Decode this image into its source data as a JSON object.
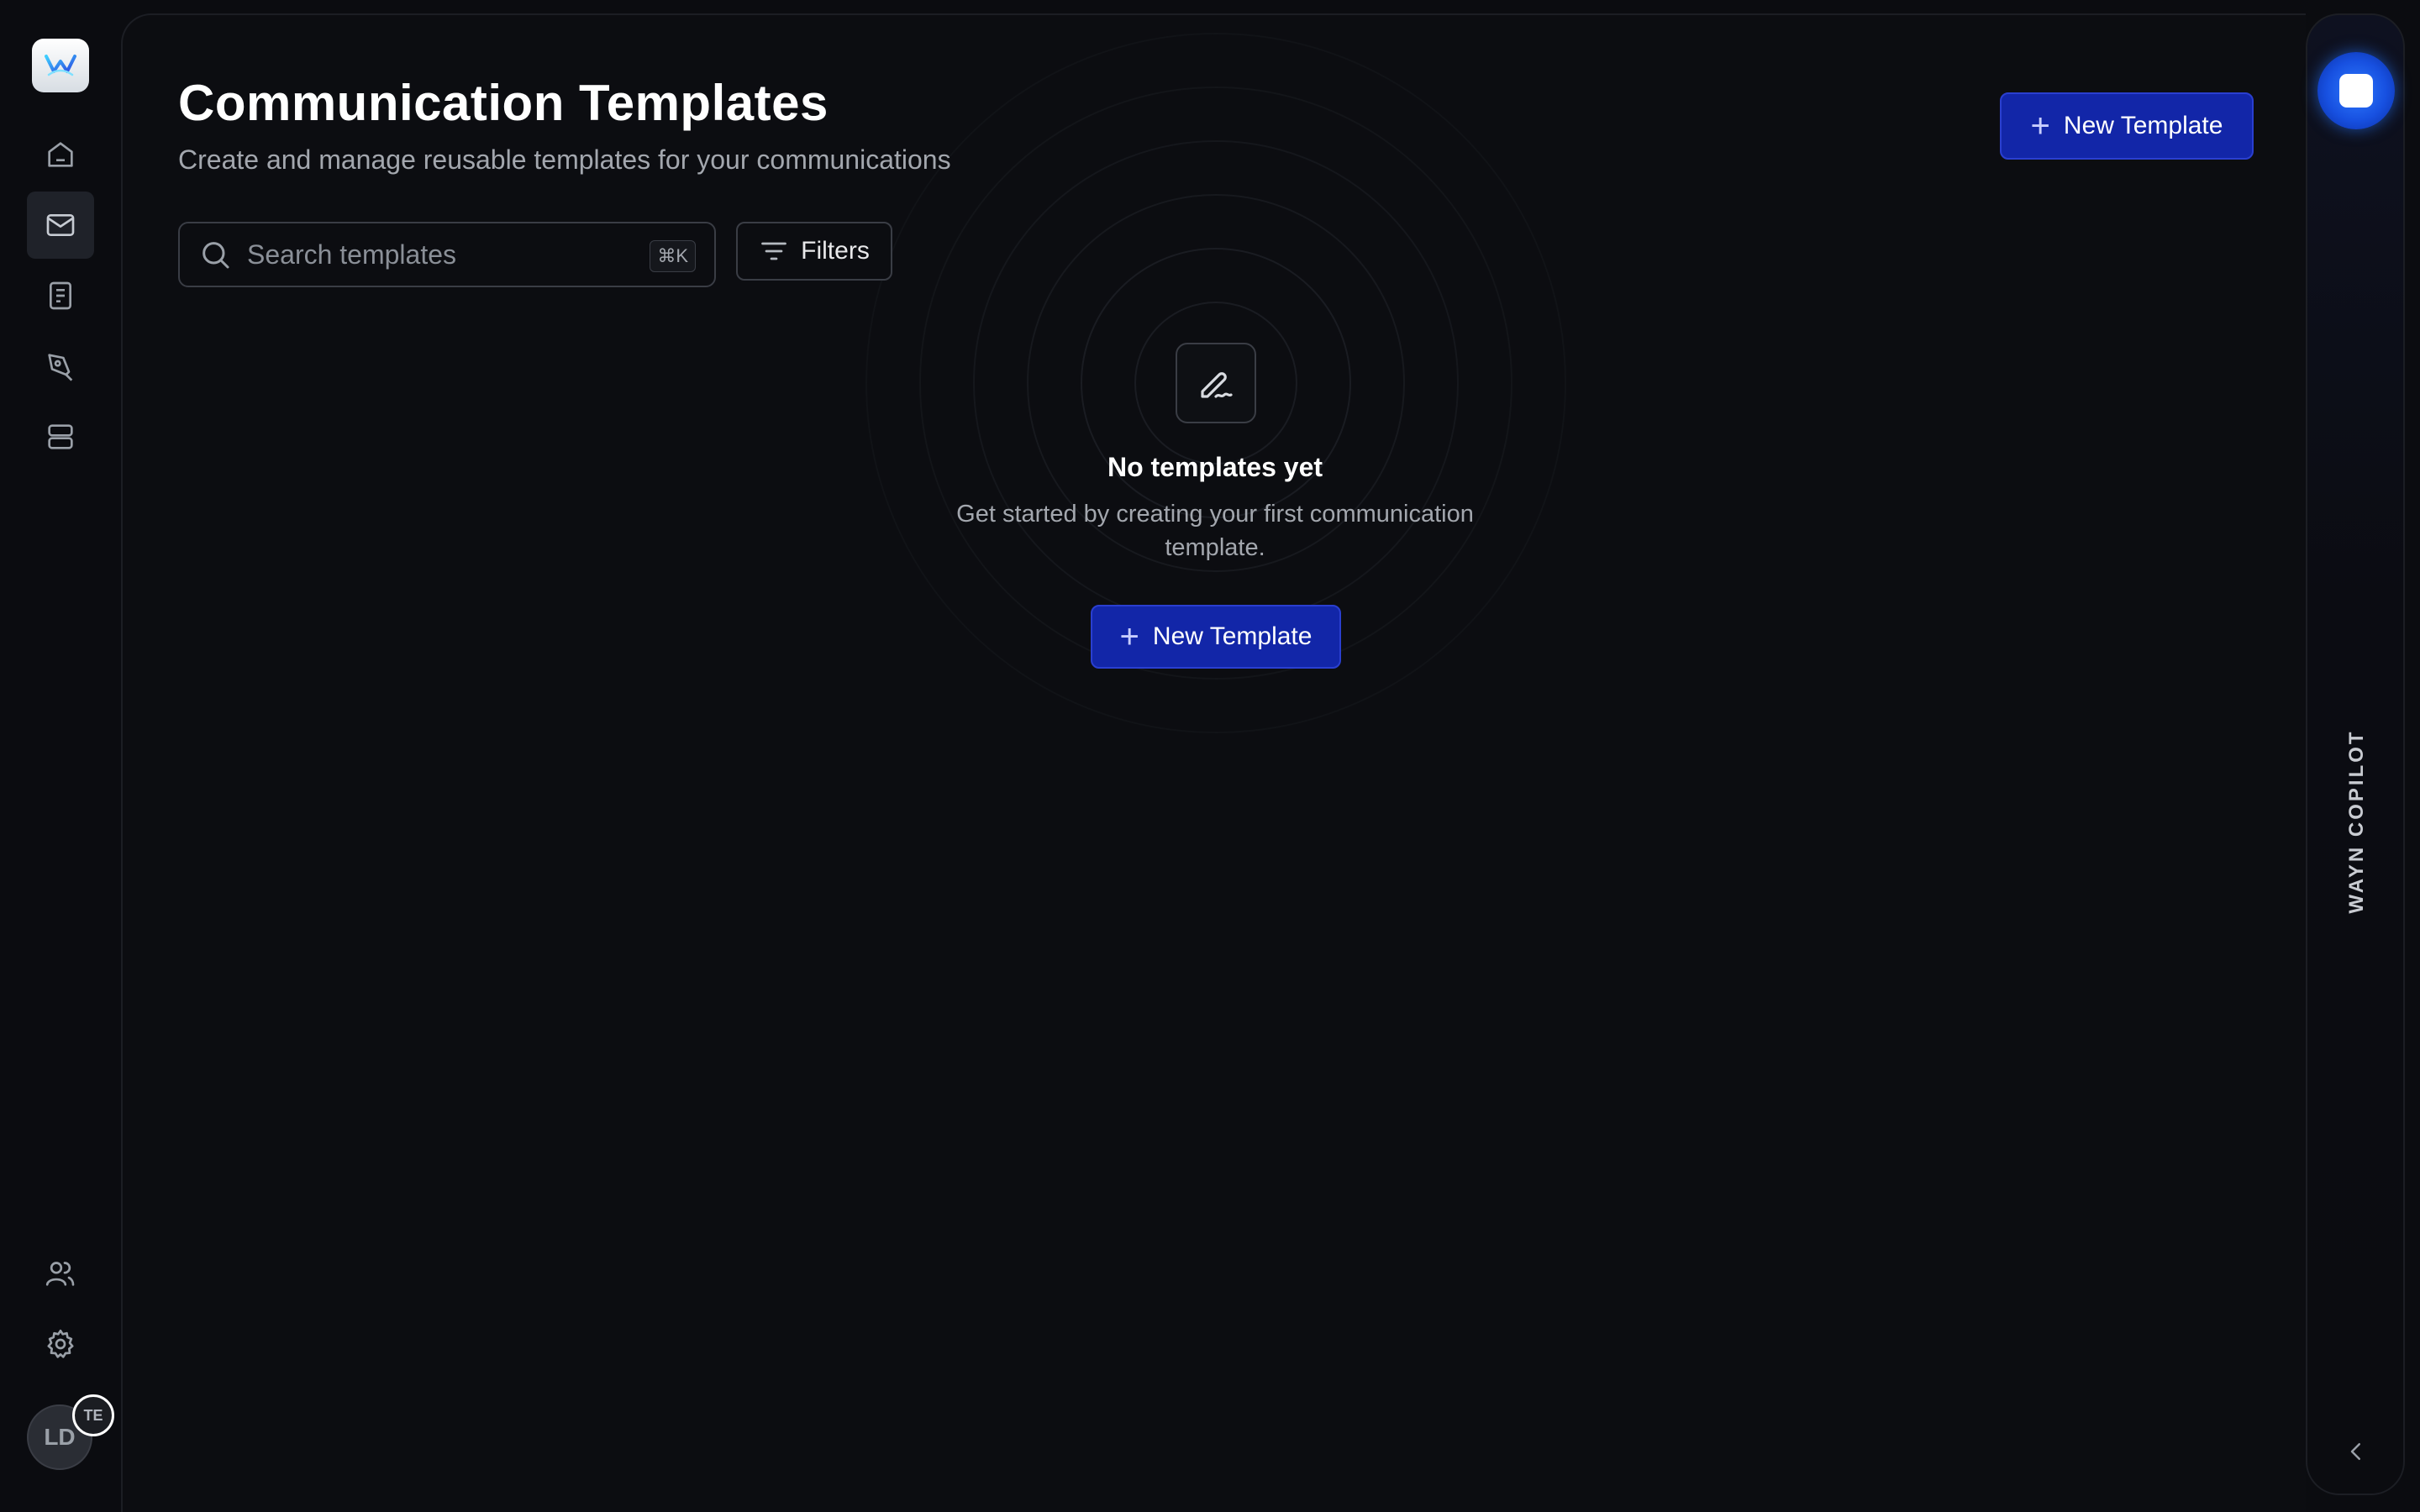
{
  "page": {
    "title": "Communication Templates",
    "subtitle": "Create and manage reusable templates for your communications"
  },
  "header": {
    "new_template_label": "New Template"
  },
  "search": {
    "placeholder": "Search templates",
    "value": "",
    "shortcut": "⌘K"
  },
  "filters": {
    "label": "Filters"
  },
  "empty_state": {
    "title": "No templates yet",
    "description": "Get started by creating your first communication template.",
    "button_label": "New Template"
  },
  "sidebar": {
    "items": [
      {
        "icon": "home-icon",
        "active": false
      },
      {
        "icon": "mail-icon",
        "active": true
      },
      {
        "icon": "document-icon",
        "active": false
      },
      {
        "icon": "pen-tool-icon",
        "active": false
      },
      {
        "icon": "server-icon",
        "active": false
      }
    ],
    "bottom_items": [
      {
        "icon": "users-icon"
      },
      {
        "icon": "settings-icon"
      }
    ],
    "avatar_initials": "LD",
    "avatar_badge": "TE"
  },
  "copilot": {
    "label": "WAYN COPILOT"
  },
  "colors": {
    "background": "#0b0c10",
    "primary": "#1226a8",
    "copilot_orb": "#1750e0"
  }
}
